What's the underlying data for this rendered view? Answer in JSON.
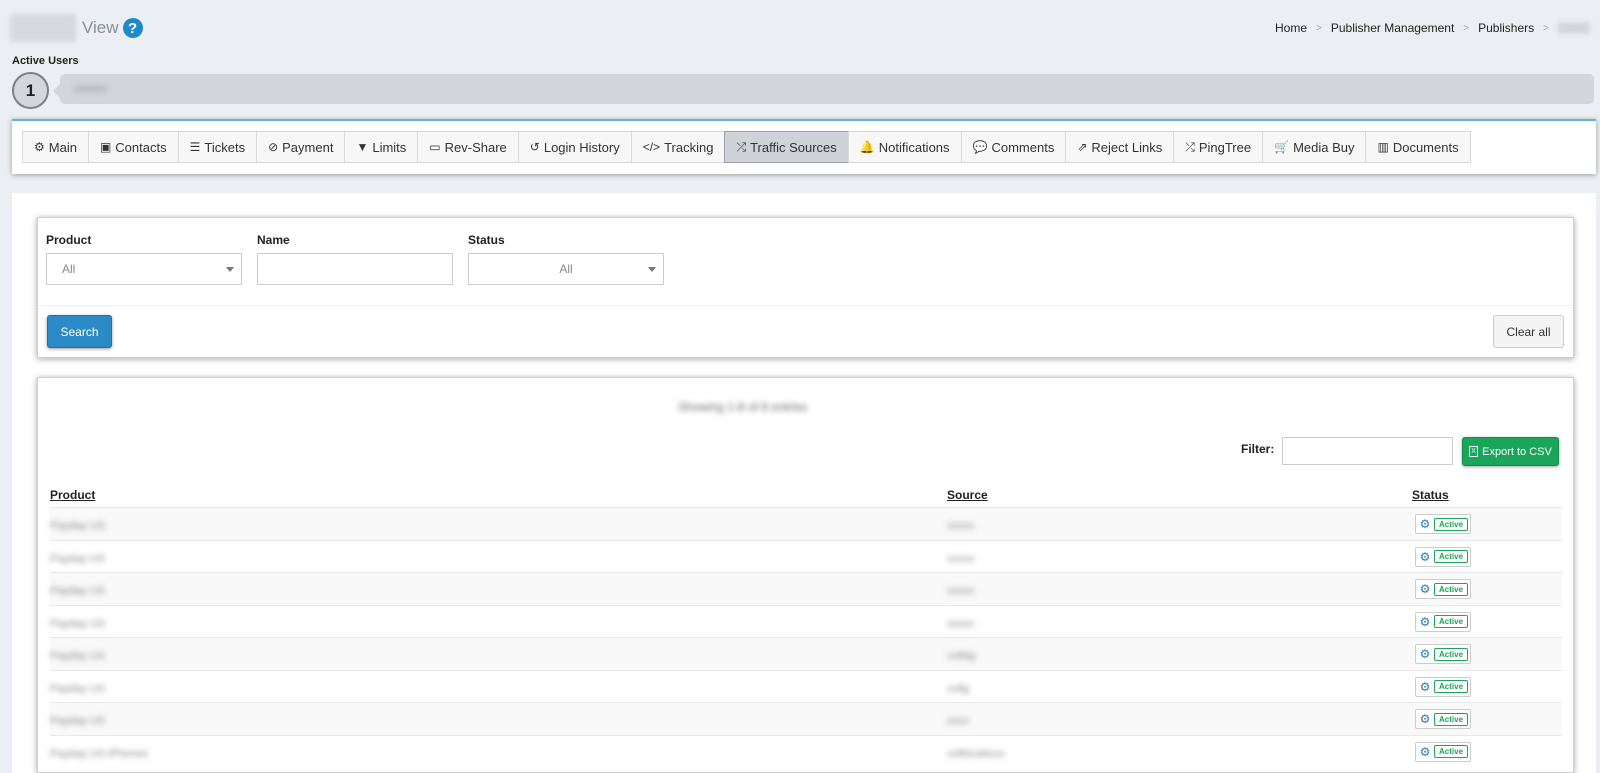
{
  "header": {
    "view_label": "View",
    "help_icon": "?"
  },
  "breadcrumb": {
    "items": [
      "Home",
      "Publisher Management",
      "Publishers"
    ],
    "separator": ">"
  },
  "active_users": {
    "label": "Active Users",
    "count": "1"
  },
  "tabs": [
    {
      "label": "Main",
      "icon": "cogs-icon",
      "glyph": "⚙"
    },
    {
      "label": "Contacts",
      "icon": "contact-card-icon",
      "glyph": "▣"
    },
    {
      "label": "Tickets",
      "icon": "list-icon",
      "glyph": "☰"
    },
    {
      "label": "Payment",
      "icon": "ban-icon",
      "glyph": "⊘"
    },
    {
      "label": "Limits",
      "icon": "filter-icon",
      "glyph": "▼"
    },
    {
      "label": "Rev-Share",
      "icon": "money-icon",
      "glyph": "▭"
    },
    {
      "label": "Login History",
      "icon": "history-icon",
      "glyph": "↺"
    },
    {
      "label": "Tracking",
      "icon": "code-icon",
      "glyph": "</>"
    },
    {
      "label": "Traffic Sources",
      "icon": "shuffle-icon",
      "glyph": "⤮"
    },
    {
      "label": "Notifications",
      "icon": "bell-icon",
      "glyph": "🔔"
    },
    {
      "label": "Comments",
      "icon": "comment-icon",
      "glyph": "💬"
    },
    {
      "label": "Reject Links",
      "icon": "external-link-icon",
      "glyph": "⇗"
    },
    {
      "label": "PingTree",
      "icon": "shuffle-icon",
      "glyph": "⤮"
    },
    {
      "label": "Media Buy",
      "icon": "cart-icon",
      "glyph": "🛒"
    },
    {
      "label": "Documents",
      "icon": "book-icon",
      "glyph": "▥"
    }
  ],
  "active_tab": "Traffic Sources",
  "search": {
    "product_label": "Product",
    "product_value": "All",
    "name_label": "Name",
    "name_value": "",
    "status_label": "Status",
    "status_value": "All",
    "search_button": "Search",
    "clear_button": "Clear all"
  },
  "table": {
    "filter_label": "Filter:",
    "filter_value": "",
    "export_button": "Export to CSV",
    "columns": [
      "Product",
      "Source",
      "Status"
    ],
    "rows": [
      {
        "status": "Active"
      },
      {
        "status": "Active"
      },
      {
        "status": "Active"
      },
      {
        "status": "Active"
      },
      {
        "status": "Active"
      },
      {
        "status": "Active"
      },
      {
        "status": "Active"
      },
      {
        "status": "Active"
      }
    ]
  },
  "colors": {
    "primary": "#2b8bc7",
    "success": "#19a55a",
    "background": "#ebeef2",
    "tab_accent": "#5fb7d8"
  }
}
